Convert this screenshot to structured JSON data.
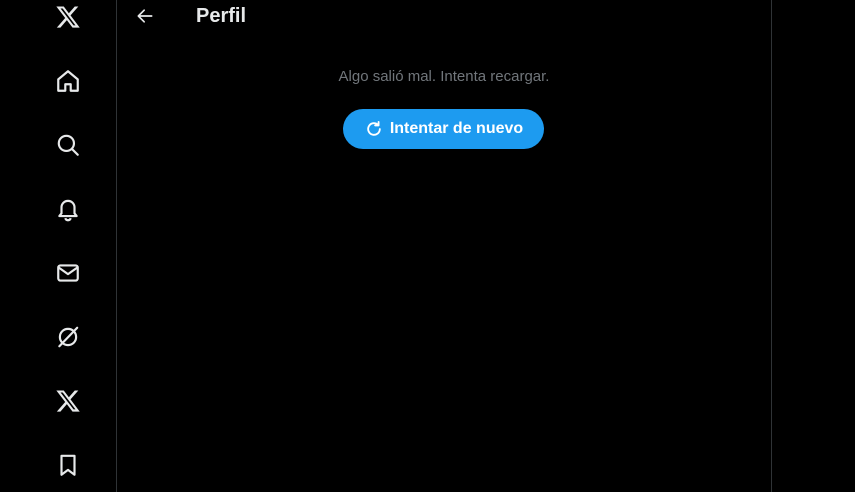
{
  "header": {
    "title": "Perfil",
    "back_icon": "back-arrow-icon"
  },
  "error": {
    "message": "Algo salió mal. Intenta recargar.",
    "retry_label": "Intentar de nuevo",
    "retry_icon": "refresh-icon"
  },
  "sidebar": {
    "items": [
      {
        "name": "logo",
        "icon": "x-logo-icon"
      },
      {
        "name": "home",
        "icon": "home-icon"
      },
      {
        "name": "explore",
        "icon": "search-icon"
      },
      {
        "name": "notifications",
        "icon": "bell-icon"
      },
      {
        "name": "messages",
        "icon": "envelope-icon"
      },
      {
        "name": "grok",
        "icon": "grok-icon"
      },
      {
        "name": "premium",
        "icon": "x-premium-icon"
      },
      {
        "name": "bookmarks",
        "icon": "bookmark-icon"
      }
    ]
  },
  "colors": {
    "background": "#000000",
    "accent": "#1d9bf0",
    "text_primary": "#e7e9ea",
    "text_secondary": "#71767b",
    "border": "#2f3336"
  }
}
